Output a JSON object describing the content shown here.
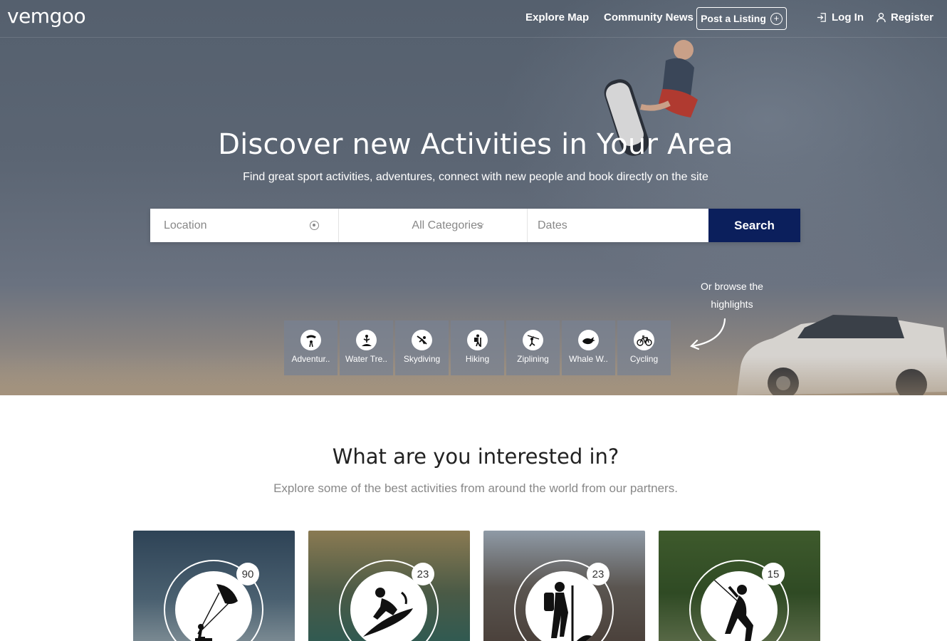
{
  "header": {
    "logo": "vemgoo",
    "nav": {
      "explore_map": "Explore Map",
      "community_news": "Community News",
      "post_listing": "Post a Listing",
      "login": "Log In",
      "register": "Register"
    }
  },
  "hero": {
    "title": "Discover new Activities in Your Area",
    "subtitle": "Find great sport activities, adventures, connect with new people and book directly on the site"
  },
  "search": {
    "location_placeholder": "Location",
    "category_selected": "All Categories",
    "dates_placeholder": "Dates",
    "button_label": "Search"
  },
  "highlights": {
    "note": "Or browse the highlights",
    "items": [
      {
        "label": "Adventur..",
        "icon": "paraglider-icon"
      },
      {
        "label": "Water Tre..",
        "icon": "water-trek-icon"
      },
      {
        "label": "Skydiving",
        "icon": "skydiving-icon"
      },
      {
        "label": "Hiking",
        "icon": "hiking-icon"
      },
      {
        "label": "Ziplining",
        "icon": "zipline-icon"
      },
      {
        "label": "Whale W..",
        "icon": "whale-icon"
      },
      {
        "label": "Cycling",
        "icon": "bicycle-icon"
      }
    ]
  },
  "interests": {
    "title": "What are you interested in?",
    "subtitle": "Explore some of the best activities from around the world from our partners.",
    "cards": [
      {
        "count": "90",
        "icon": "kitesurf-icon",
        "bg": "#3b5064"
      },
      {
        "count": "23",
        "icon": "surfer-icon",
        "bg": "#5a6a4a"
      },
      {
        "count": "23",
        "icon": "hiker-icon",
        "bg": "#6b6560"
      },
      {
        "count": "15",
        "icon": "climber-icon",
        "bg": "#3f5a30"
      }
    ]
  },
  "colors": {
    "search_button": "#0b1f5c",
    "hero_overlay": "#5b6573"
  }
}
